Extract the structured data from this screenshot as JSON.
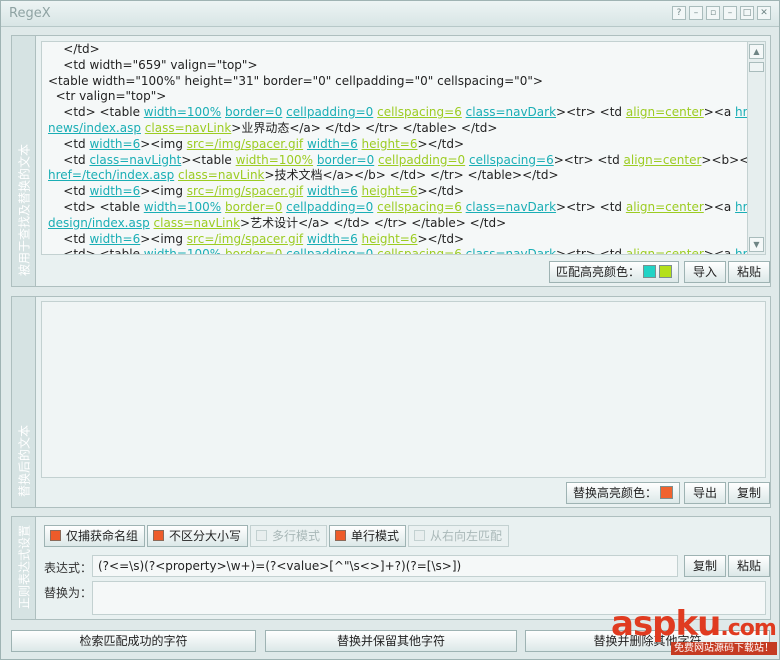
{
  "window": {
    "title": "RegeX",
    "controls": [
      "?",
      "–",
      "▫",
      "–",
      "□",
      "✕"
    ]
  },
  "source_panel": {
    "label": "被用于查找及替换的文本",
    "code_lines": [
      [
        [
          "t",
          "    </td>"
        ]
      ],
      [
        [
          "t",
          "    <td width=\"659\" valign=\"top\">"
        ]
      ],
      [
        [
          "t",
          "<table width=\"100%\" height=\"31\" border=\"0\" cellpadding=\"0\" cellspacing=\"0\">"
        ]
      ],
      [
        [
          "t",
          "  <tr valign=\"top\">"
        ]
      ],
      [
        [
          "t",
          "    <td> <table "
        ],
        [
          "k",
          "width=100%"
        ],
        [
          "t",
          " "
        ],
        [
          "k",
          "border=0"
        ],
        [
          "t",
          " "
        ],
        [
          "k",
          "cellpadding=0"
        ],
        [
          "t",
          " "
        ],
        [
          "v",
          "cellspacing=6"
        ],
        [
          "t",
          " "
        ],
        [
          "k",
          "class=navDark"
        ],
        [
          "t",
          "><tr> <td "
        ],
        [
          "v",
          "align=center"
        ],
        [
          "t",
          "><a "
        ],
        [
          "k",
          "href=/"
        ]
      ],
      [
        [
          "k",
          "news/index.asp"
        ],
        [
          "t",
          " "
        ],
        [
          "v",
          "class=navLink"
        ],
        [
          "t",
          ">业界动态</a> </td> </tr> </table> </td>"
        ]
      ],
      [
        [
          "t",
          "    <td "
        ],
        [
          "k",
          "width=6"
        ],
        [
          "t",
          "><img "
        ],
        [
          "v",
          "src=/img/spacer.gif"
        ],
        [
          "t",
          " "
        ],
        [
          "k",
          "width=6"
        ],
        [
          "t",
          " "
        ],
        [
          "v",
          "height=6"
        ],
        [
          "t",
          "></td>"
        ]
      ],
      [
        [
          "t",
          "    <td "
        ],
        [
          "k",
          "class=navLight"
        ],
        [
          "t",
          "><table "
        ],
        [
          "v",
          "width=100%"
        ],
        [
          "t",
          " "
        ],
        [
          "k",
          "border=0"
        ],
        [
          "t",
          " "
        ],
        [
          "v",
          "cellpadding=0"
        ],
        [
          "t",
          " "
        ],
        [
          "k",
          "cellspacing=6"
        ],
        [
          "t",
          "><tr> <td "
        ],
        [
          "v",
          "align=center"
        ],
        [
          "t",
          "><b><a"
        ]
      ],
      [
        [
          "k",
          "href=/tech/index.asp"
        ],
        [
          "t",
          " "
        ],
        [
          "v",
          "class=navLink"
        ],
        [
          "t",
          ">技术文档</a></b> </td> </tr> </table></td>"
        ]
      ],
      [
        [
          "t",
          "    <td "
        ],
        [
          "k",
          "width=6"
        ],
        [
          "t",
          "><img "
        ],
        [
          "v",
          "src=/img/spacer.gif"
        ],
        [
          "t",
          " "
        ],
        [
          "k",
          "width=6"
        ],
        [
          "t",
          " "
        ],
        [
          "v",
          "height=6"
        ],
        [
          "t",
          "></td>"
        ]
      ],
      [
        [
          "t",
          "    <td> <table "
        ],
        [
          "k",
          "width=100%"
        ],
        [
          "t",
          " "
        ],
        [
          "v",
          "border=0"
        ],
        [
          "t",
          " "
        ],
        [
          "k",
          "cellpadding=0"
        ],
        [
          "t",
          " "
        ],
        [
          "v",
          "cellspacing=6"
        ],
        [
          "t",
          " "
        ],
        [
          "k",
          "class=navDark"
        ],
        [
          "t",
          "><tr> <td "
        ],
        [
          "v",
          "align=center"
        ],
        [
          "t",
          "><a "
        ],
        [
          "k",
          "href=/"
        ]
      ],
      [
        [
          "k",
          "design/index.asp"
        ],
        [
          "t",
          " "
        ],
        [
          "v",
          "class=navLink"
        ],
        [
          "t",
          ">艺术设计</a> </td> </tr> </table> </td>"
        ]
      ],
      [
        [
          "t",
          "    <td "
        ],
        [
          "k",
          "width=6"
        ],
        [
          "t",
          "><img "
        ],
        [
          "v",
          "src=/img/spacer.gif"
        ],
        [
          "t",
          " "
        ],
        [
          "k",
          "width=6"
        ],
        [
          "t",
          " "
        ],
        [
          "v",
          "height=6"
        ],
        [
          "t",
          "></td>"
        ]
      ],
      [
        [
          "t",
          "    <td> <table "
        ],
        [
          "k",
          "width=100%"
        ],
        [
          "t",
          " "
        ],
        [
          "v",
          "border=0"
        ],
        [
          "t",
          " "
        ],
        [
          "k",
          "cellpadding=0"
        ],
        [
          "t",
          " "
        ],
        [
          "v",
          "cellspacing=6"
        ],
        [
          "t",
          " "
        ],
        [
          "k",
          "class=navDark"
        ],
        [
          "t",
          "><tr> <td "
        ],
        [
          "v",
          "align=center"
        ],
        [
          "t",
          "><a "
        ],
        [
          "k",
          "href=/"
        ]
      ]
    ],
    "highlight_label": "匹配高亮颜色：",
    "highlight_colors": [
      "#22d3c5",
      "#b4e01a"
    ],
    "import_button": "导入",
    "paste_button": "粘贴"
  },
  "result_panel": {
    "label": "替换后的文本",
    "highlight_label": "替换高亮颜色：",
    "highlight_color": "#f0622e",
    "export_button": "导出",
    "copy_button": "复制"
  },
  "settings_panel": {
    "label": "正则表达式设置",
    "options": [
      {
        "label": "仅捕获命名组",
        "checked": true,
        "enabled": true
      },
      {
        "label": "不区分大小写",
        "checked": true,
        "enabled": true
      },
      {
        "label": "多行模式",
        "checked": false,
        "enabled": false
      },
      {
        "label": "单行模式",
        "checked": true,
        "enabled": true
      },
      {
        "label": "从右向左匹配",
        "checked": false,
        "enabled": false
      }
    ],
    "expression_label": "表达式：",
    "expression_value": "(?<=\\s)(?<property>\\w+)=(?<value>[^\"\\s<>]+?)(?=[\\s>])",
    "copy_button": "复制",
    "paste_button": "粘贴",
    "replace_label": "替换为：",
    "replace_value": ""
  },
  "actions": {
    "search_button": "检索匹配成功的字符",
    "replace_keep_button": "替换并保留其他字符",
    "replace_delete_button": "替换并删除其他字符"
  },
  "watermark": {
    "logo": "aspku",
    "suffix": ".com",
    "tagline": "免费网站源码下载站！"
  }
}
